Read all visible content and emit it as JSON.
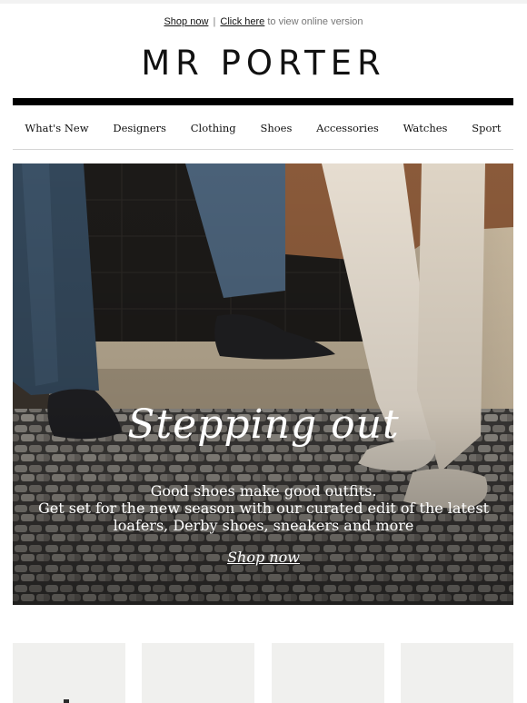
{
  "preheader": {
    "shop_now": "Shop now",
    "separator": "|",
    "click_here": "Click here",
    "suffix": "to view online version"
  },
  "brand": {
    "logo": "MR PORTER"
  },
  "nav": {
    "items": [
      "What's New",
      "Designers",
      "Clothing",
      "Shoes",
      "Accessories",
      "Watches",
      "Sport"
    ]
  },
  "hero": {
    "title": "Stepping out",
    "lines": [
      "Good shoes make good outfits.",
      "Get set for the new season with our curated edit of the latest",
      "loafers, Derby shoes, sneakers and more"
    ],
    "cta": "Shop now"
  },
  "products": {
    "count_visible": 4
  }
}
